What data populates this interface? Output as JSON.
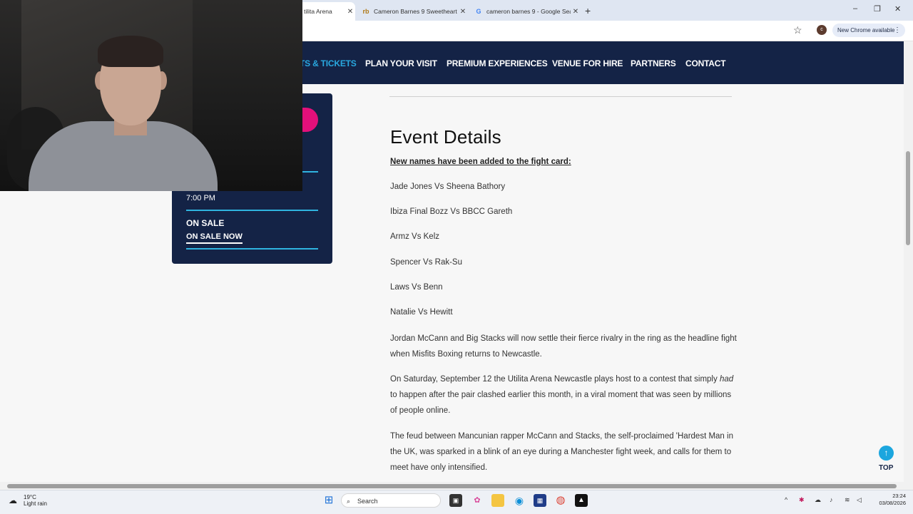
{
  "browser": {
    "tabs": [
      {
        "title": "tilita Arena",
        "active": true
      },
      {
        "title": "Cameron Barnes 9 Sweetheart",
        "favicon": "rb"
      },
      {
        "title": "cameron barnes 9 - Google Sea",
        "favicon": "G"
      }
    ],
    "new_tab_symbol": "+",
    "window_controls": {
      "minimize": "–",
      "restore": "❐",
      "close": "✕"
    },
    "update_chip": "New Chrome available",
    "profile_initial": "c"
  },
  "site_nav": {
    "items": [
      "TS & TICKETS",
      "PLAN YOUR VISIT",
      "PREMIUM EXPERIENCES",
      "VENUE FOR HIRE",
      "PARTNERS",
      "CONTACT"
    ]
  },
  "sidebar": {
    "time": "7:00 PM",
    "on_sale_heading": "ON SALE",
    "on_sale_link": "ON SALE NOW"
  },
  "event": {
    "heading": "Event Details",
    "subheading": "New names have been added to the fight card:",
    "fights": [
      "Jade Jones Vs Sheena Bathory",
      "Ibiza Final Bozz Vs BBCC Gareth",
      "Armz Vs Kelz",
      "Spencer Vs Rak-Su",
      "Laws Vs Benn",
      "Natalie Vs Hewitt"
    ],
    "para1": "Jordan McCann and Big Stacks will now settle their fierce rivalry in the ring as the headline fight when Misfits Boxing returns to Newcastle.",
    "para2_before": "On Saturday, September 12 the Utilita Arena Newcastle plays host to a contest that simply ",
    "para2_em": "had",
    "para2_after": " to happen after the pair clashed earlier this month, in a viral moment that was seen by millions of people online.",
    "para3": "The feud between Mancunian rapper McCann and Stacks, the self-proclaimed 'Hardest Man in the UK, was sparked in a blink of an eye during a Manchester fight week, and calls for them to meet have only intensified."
  },
  "top_button": {
    "symbol": "↑",
    "label": "TOP"
  },
  "taskbar": {
    "weather_temp": "19°C",
    "weather_desc": "Light rain",
    "search_label": "Search",
    "time": "23:24",
    "date": "03/08/2026"
  }
}
